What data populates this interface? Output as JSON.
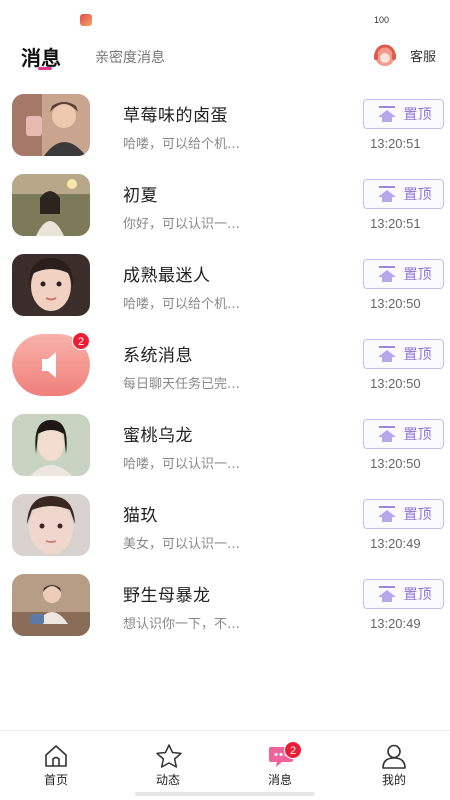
{
  "status_bar": {
    "battery": "100"
  },
  "header": {
    "tab_active": "消息",
    "tab_other": "亲密度消息",
    "service_label": "客服"
  },
  "conversations": [
    {
      "name": "草莓味的卤蛋",
      "preview": "哈喽，可以给个机…",
      "time": "13:20:51",
      "pin_label": "置顶",
      "badge": ""
    },
    {
      "name": "初夏",
      "preview": "你好，可以认识一…",
      "time": "13:20:51",
      "pin_label": "置顶",
      "badge": ""
    },
    {
      "name": "成熟最迷人",
      "preview": "哈喽，可以给个机…",
      "time": "13:20:50",
      "pin_label": "置顶",
      "badge": ""
    },
    {
      "name": "系统消息",
      "preview": "每日聊天任务已完…",
      "time": "13:20:50",
      "pin_label": "置顶",
      "badge": "2"
    },
    {
      "name": "蜜桃乌龙",
      "preview": "哈喽，可以认识一…",
      "time": "13:20:50",
      "pin_label": "置顶",
      "badge": ""
    },
    {
      "name": "猫玖",
      "preview": "美女，可以认识一…",
      "time": "13:20:49",
      "pin_label": "置顶",
      "badge": ""
    },
    {
      "name": "野生母暴龙",
      "preview": "想认识你一下，不…",
      "time": "13:20:49",
      "pin_label": "置顶",
      "badge": ""
    }
  ],
  "tab_bar": {
    "items": [
      {
        "label": "首页",
        "icon": "home-icon"
      },
      {
        "label": "动态",
        "icon": "star-icon"
      },
      {
        "label": "消息",
        "icon": "chat-icon",
        "badge": "2"
      },
      {
        "label": "我的",
        "icon": "person-icon"
      }
    ]
  },
  "colors": {
    "accent": "#e4388a",
    "pin_text": "#8a73d6",
    "badge": "#ee1d36"
  }
}
